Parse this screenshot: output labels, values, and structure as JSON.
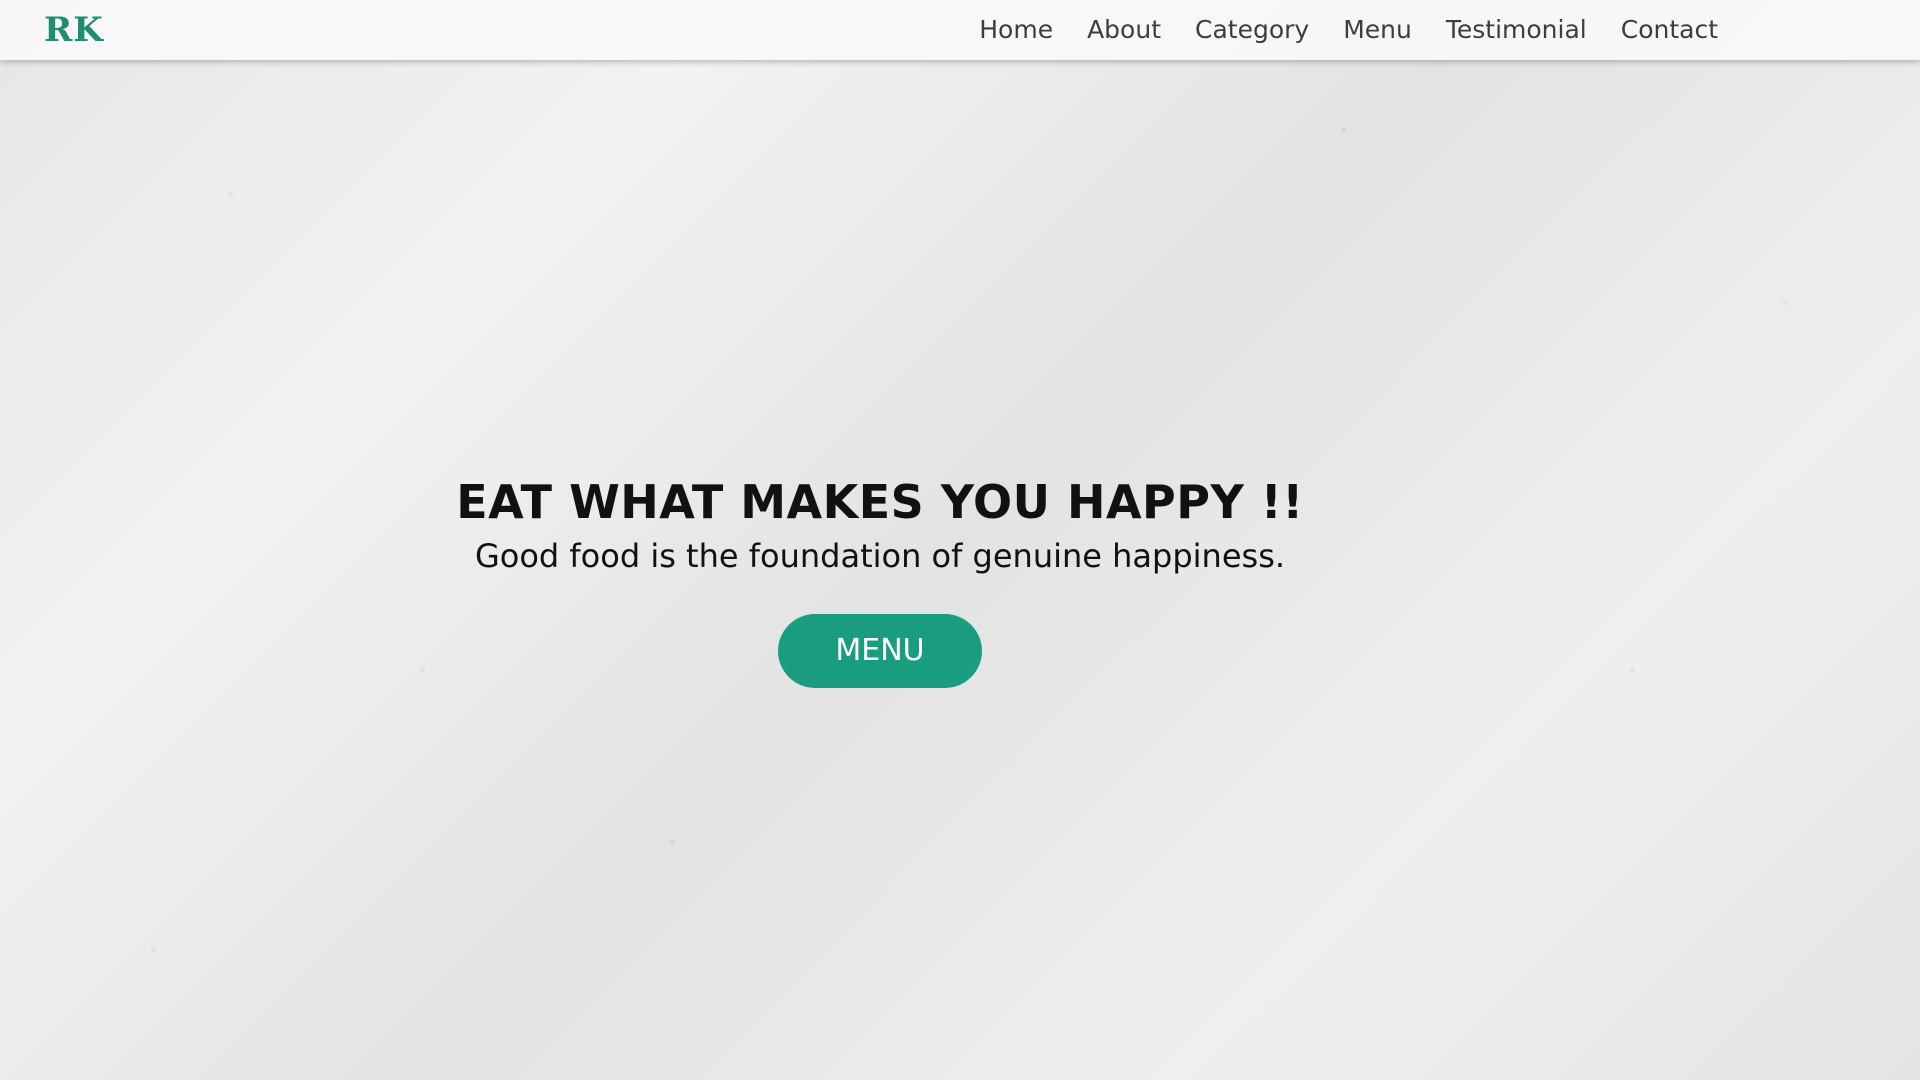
{
  "nav": {
    "logo": "RK",
    "links": [
      "Home",
      "About",
      "Category",
      "Menu",
      "Testimonial",
      "Contact"
    ]
  },
  "hero": {
    "title": "EAT WHAT MAKES YOU HAPPY !!",
    "subtitle": "Good food is the foundation of genuine happiness.",
    "button_label": "MENU"
  },
  "colors": {
    "accent": "#1a9c7f",
    "text": "#111111",
    "nav_text": "#3d3d3d"
  }
}
